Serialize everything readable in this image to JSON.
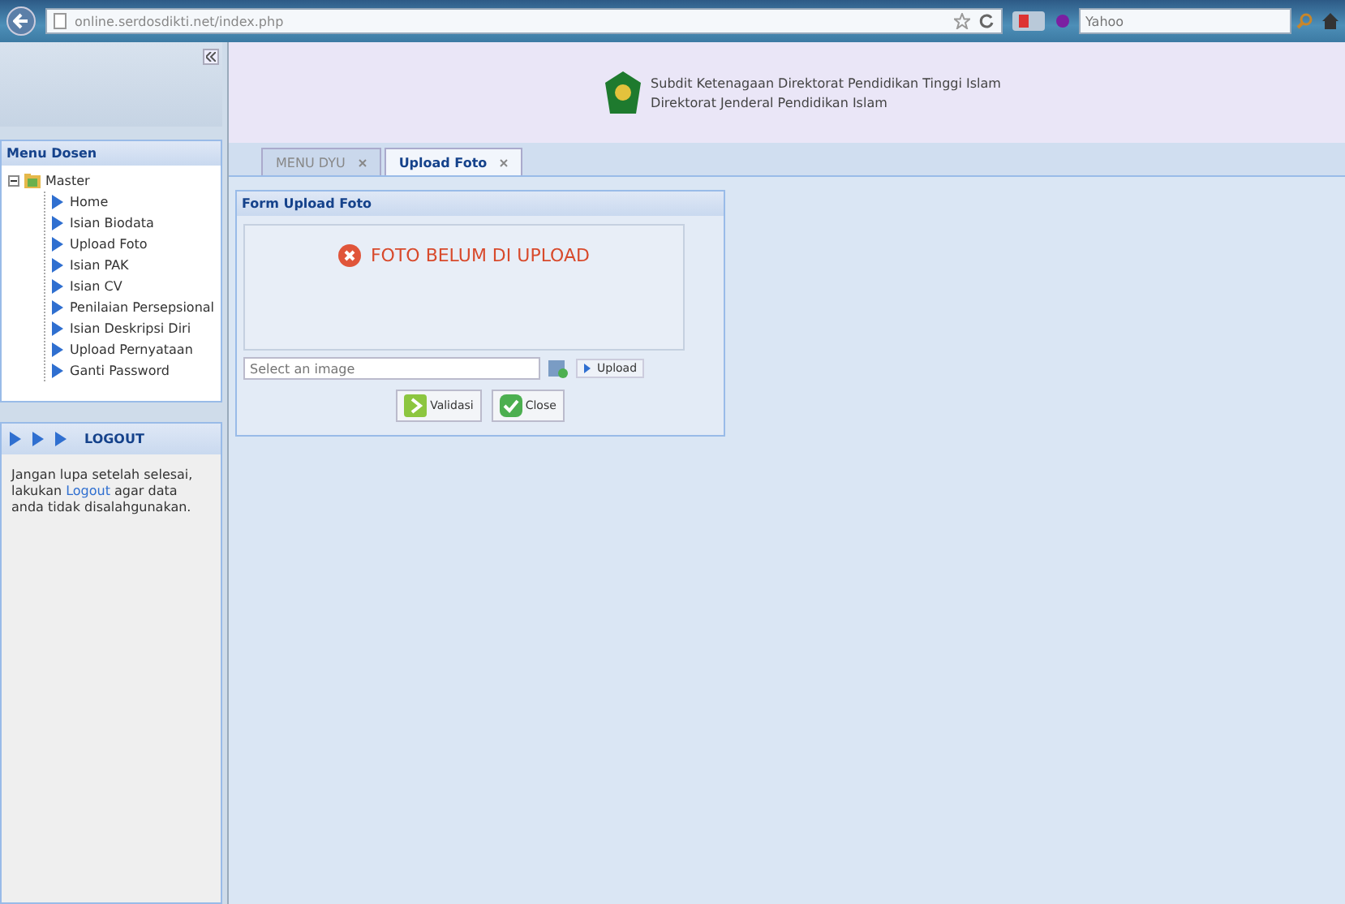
{
  "browser": {
    "url": "online.serdosdikti.net/index.php",
    "search_placeholder": "Yahoo"
  },
  "header": {
    "lines": [
      "Subdit Ketenagaan Direktorat Pendidikan Tinggi Islam",
      "Direktorat Jenderal Pendidikan Islam"
    ]
  },
  "tabs": [
    {
      "label": "MENU DYU",
      "selected": false
    },
    {
      "label": "Upload Foto",
      "selected": true
    }
  ],
  "sidebar": {
    "title": "Menu Dosen",
    "root": {
      "label": "Master",
      "expanded": true,
      "children": [
        {
          "label": "Home"
        },
        {
          "label": "Isian Biodata"
        },
        {
          "label": "Upload Foto"
        },
        {
          "label": "Isian PAK"
        },
        {
          "label": "Isian CV"
        },
        {
          "label": "Penilaian Persepsional"
        },
        {
          "label": "Isian Deskripsi Diri"
        },
        {
          "label": "Upload Pernyataan"
        },
        {
          "label": "Ganti Password"
        }
      ]
    }
  },
  "logout_panel": {
    "title": "LOGOUT",
    "link": "Logout",
    "note_before": "Jangan lupa setelah selesai, lakukan ",
    "note_after": " agar data anda tidak disalahgunakan."
  },
  "form": {
    "title": "Form Upload Foto",
    "message": "FOTO BELUM DI UPLOAD",
    "file_placeholder": "Select an image",
    "upload_button": "Upload",
    "buttons": [
      {
        "kind": "validate",
        "label": "Validasi"
      },
      {
        "kind": "close",
        "label": "Close"
      }
    ]
  }
}
